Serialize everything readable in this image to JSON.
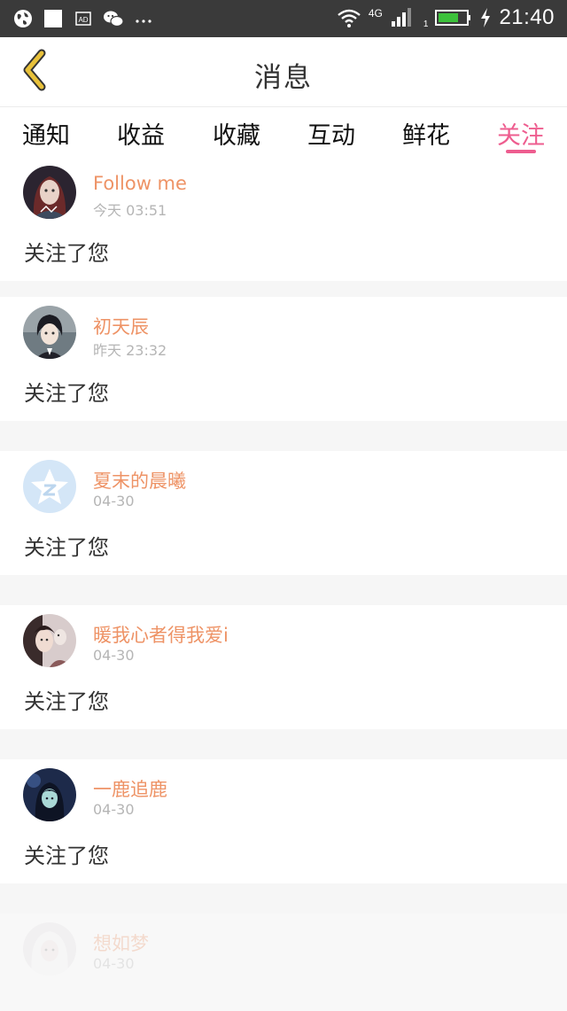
{
  "status_bar": {
    "network": "4G",
    "sim_slot": "1",
    "time": "21:40",
    "battery_color": "#3cc13b",
    "icons": [
      "globe-icon",
      "square-icon",
      "ad-icon",
      "wechat-icon",
      "more-icon",
      "wifi-icon",
      "signal-icon",
      "battery-icon",
      "charging-icon"
    ]
  },
  "header": {
    "title": "消息",
    "back_icon": "chevron-left-icon",
    "back_color": "#e8c13a"
  },
  "tabs": {
    "items": [
      {
        "label": "通知"
      },
      {
        "label": "收益"
      },
      {
        "label": "收藏"
      },
      {
        "label": "互动"
      },
      {
        "label": "鲜花"
      },
      {
        "label": "关注"
      }
    ],
    "active_index": 5,
    "active_color": "#ee5d8f"
  },
  "notifications": [
    {
      "username": "Follow me",
      "time": "今天 03:51",
      "message": "关注了您",
      "avatar": "avatar-girl-icon"
    },
    {
      "username": "初天辰",
      "time": "昨天 23:32",
      "message": "关注了您",
      "avatar": "avatar-boy-icon"
    },
    {
      "username": "夏末的晨曦",
      "time": "04-30",
      "message": "关注了您",
      "avatar": "qzone-star-icon"
    },
    {
      "username": "暖我心者得我爱i",
      "time": "04-30",
      "message": "关注了您",
      "avatar": "avatar-photo-icon"
    },
    {
      "username": "一鹿追鹿",
      "time": "04-30",
      "message": "关注了您",
      "avatar": "avatar-dark-icon"
    },
    {
      "username": "想如梦",
      "time": "04-30",
      "message": "",
      "avatar": "avatar-white-icon"
    }
  ],
  "colors": {
    "username": "#ee9366",
    "time": "#b5b5b5",
    "separator": "#f6f6f6"
  }
}
